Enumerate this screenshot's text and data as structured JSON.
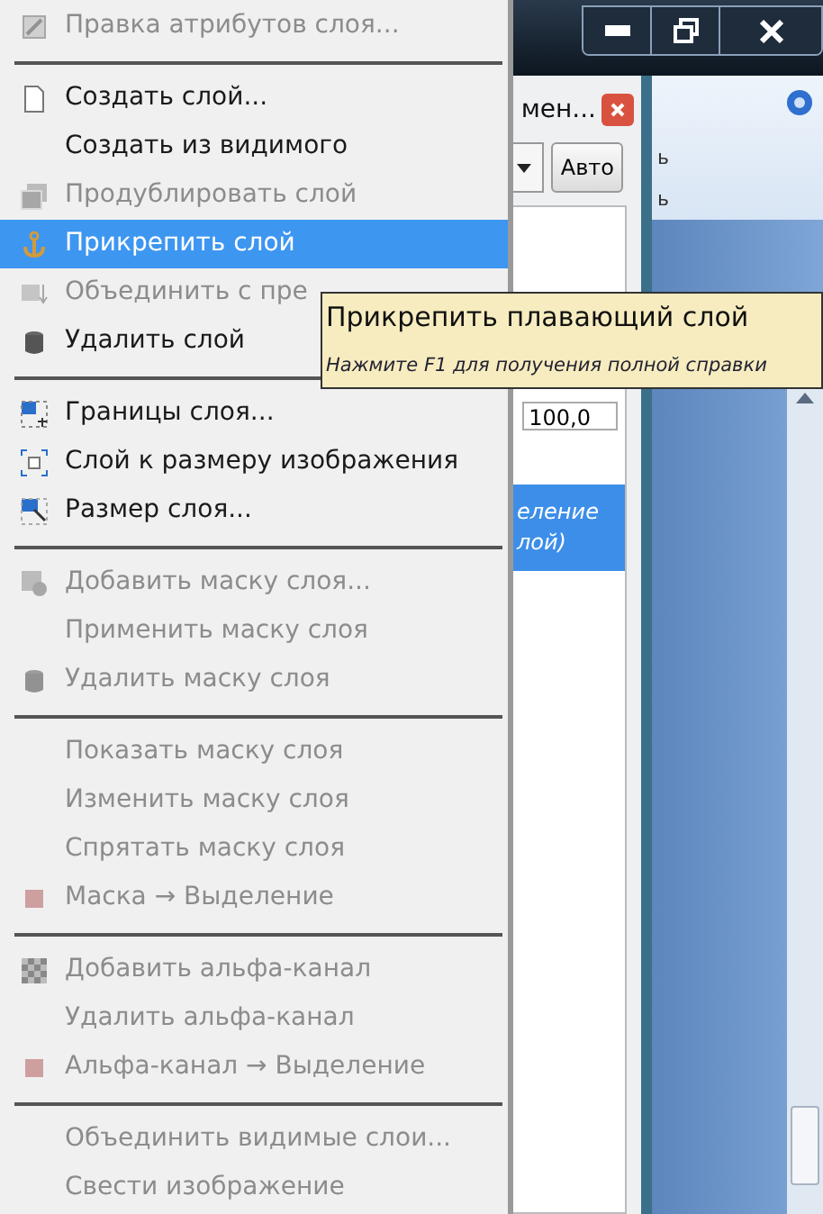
{
  "ribbon": {
    "column_1": [
      "ь",
      "ь"
    ]
  },
  "dialog": {
    "title": "мен...",
    "mode_button": "Авто",
    "opacity": "100,0",
    "layer_row": {
      "line_1": "еление",
      "line_2": "лой)",
      "selected": true
    }
  },
  "menu": {
    "items": [
      {
        "kind": "item",
        "label": "Правка атрибутов слоя...",
        "disabled": true,
        "selected": false
      },
      {
        "kind": "separator"
      },
      {
        "kind": "item",
        "label": "Создать слой...",
        "disabled": false,
        "selected": false
      },
      {
        "kind": "item",
        "label": "Создать из видимого",
        "disabled": false,
        "selected": false
      },
      {
        "kind": "item",
        "label": "Продублировать слой",
        "disabled": true,
        "selected": false
      },
      {
        "kind": "item",
        "label": "Прикрепить слой",
        "disabled": false,
        "selected": true
      },
      {
        "kind": "item",
        "label": "Объединить с пре",
        "disabled": true,
        "selected": false
      },
      {
        "kind": "item",
        "label": "Удалить слой",
        "disabled": false,
        "selected": false
      },
      {
        "kind": "separator"
      },
      {
        "kind": "item",
        "label": "Границы слоя...",
        "disabled": false,
        "selected": false
      },
      {
        "kind": "item",
        "label": "Слой к размеру изображения",
        "disabled": false,
        "selected": false
      },
      {
        "kind": "item",
        "label": "Размер слоя...",
        "disabled": false,
        "selected": false
      },
      {
        "kind": "separator"
      },
      {
        "kind": "item",
        "label": "Добавить маску слоя...",
        "disabled": true,
        "selected": false
      },
      {
        "kind": "item",
        "label": "Применить маску слоя",
        "disabled": true,
        "selected": false
      },
      {
        "kind": "item",
        "label": "Удалить маску слоя",
        "disabled": true,
        "selected": false
      },
      {
        "kind": "separator"
      },
      {
        "kind": "item",
        "label": "Показать маску слоя",
        "disabled": true,
        "selected": false
      },
      {
        "kind": "item",
        "label": "Изменить маску слоя",
        "disabled": true,
        "selected": false
      },
      {
        "kind": "item",
        "label": "Спрятать маску слоя",
        "disabled": true,
        "selected": false
      },
      {
        "kind": "item",
        "label": "Маска → Выделение",
        "disabled": true,
        "selected": false
      },
      {
        "kind": "separator"
      },
      {
        "kind": "item",
        "label": "Добавить альфа-канал",
        "disabled": true,
        "selected": false
      },
      {
        "kind": "item",
        "label": "Удалить альфа-канал",
        "disabled": true,
        "selected": false
      },
      {
        "kind": "item",
        "label": "Альфа-канал → Выделение",
        "disabled": true,
        "selected": false
      },
      {
        "kind": "separator"
      },
      {
        "kind": "item",
        "label": "Объединить видимые слои...",
        "disabled": true,
        "selected": false
      },
      {
        "kind": "item",
        "label": "Свести изображение",
        "disabled": true,
        "selected": false
      }
    ]
  },
  "tooltip": {
    "title": "Прикрепить плавающий слой",
    "hint": "Нажмите F1 для получения полной справки"
  }
}
